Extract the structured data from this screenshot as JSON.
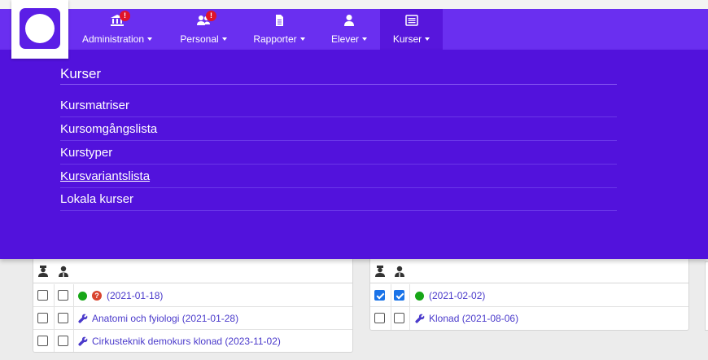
{
  "nav": {
    "items": [
      {
        "label": "Administration",
        "icon": "bank-icon",
        "badge": "!"
      },
      {
        "label": "Personal",
        "icon": "users-icon",
        "badge": "!"
      },
      {
        "label": "Rapporter",
        "icon": "document-icon"
      },
      {
        "label": "Elever",
        "icon": "user-icon"
      },
      {
        "label": "Kurser",
        "icon": "list-icon",
        "active": true
      }
    ]
  },
  "dropdown": {
    "title": "Kurser",
    "items": [
      {
        "label": "Kursmatriser"
      },
      {
        "label": "Kursomgångslista"
      },
      {
        "label": "Kurstyper"
      },
      {
        "label": "Kursvariantslista",
        "hover": true
      },
      {
        "label": "Lokala kurser"
      }
    ]
  },
  "cards": [
    {
      "header_icons": [
        "teacher-icon",
        "student-icon"
      ],
      "rows": [
        {
          "checked1": false,
          "checked2": false,
          "status": "green",
          "question": "?",
          "text": "(2021-01-18)"
        },
        {
          "checked1": false,
          "checked2": false,
          "icon": "wrench-icon",
          "text": "Anatomi och fyiologi (2021-01-28)"
        },
        {
          "checked1": false,
          "checked2": false,
          "icon": "wrench-icon",
          "text": "Cirkusteknik demokurs klonad (2023-11-02)"
        }
      ]
    },
    {
      "header_icons": [
        "teacher-icon",
        "student-icon"
      ],
      "rows": [
        {
          "checked1": true,
          "checked2": true,
          "status": "green",
          "text": "(2021-02-02)"
        },
        {
          "checked1": false,
          "checked2": false,
          "icon": "wrench-icon",
          "text": "Klonad (2021-08-06)"
        }
      ]
    }
  ],
  "colors": {
    "navbar": "#6a2ff0",
    "dropdown": "#5212dc",
    "status_green": "#17a617",
    "link": "#4a3acb"
  }
}
